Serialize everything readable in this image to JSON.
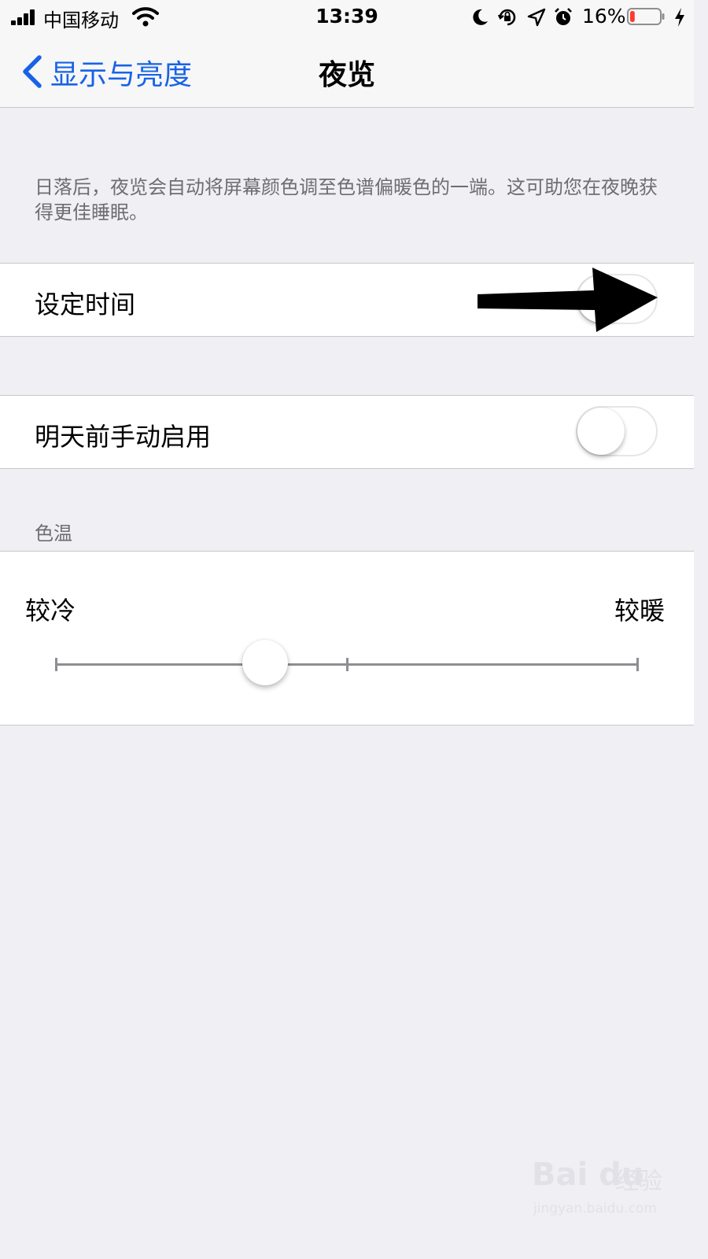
{
  "status_bar": {
    "carrier": "中国移动",
    "time": "13:39",
    "battery_percent": "16%",
    "battery_level": 0.16,
    "icons": [
      "signal-icon",
      "wifi-icon",
      "moon-icon",
      "orientation-lock-icon",
      "location-icon",
      "alarm-icon",
      "battery-icon",
      "charging-icon"
    ]
  },
  "nav": {
    "back_label": "显示与亮度",
    "title": "夜览",
    "accent_color": "#1763e6"
  },
  "description": "日落后，夜览会自动将屏幕颜色调至色谱偏暖色的一端。这可助您在夜晚获得更佳睡眠。",
  "settings": {
    "scheduled": {
      "label": "设定时间",
      "enabled": false
    },
    "manual": {
      "label": "明天前手动启用",
      "enabled": false
    }
  },
  "color_temperature": {
    "section_header": "色温",
    "less_warm_label": "较冷",
    "more_warm_label": "较暖",
    "value": 0.36
  },
  "watermark": {
    "logo": "Bai du",
    "brand": "经验",
    "url": "jingyan.baidu.com"
  }
}
